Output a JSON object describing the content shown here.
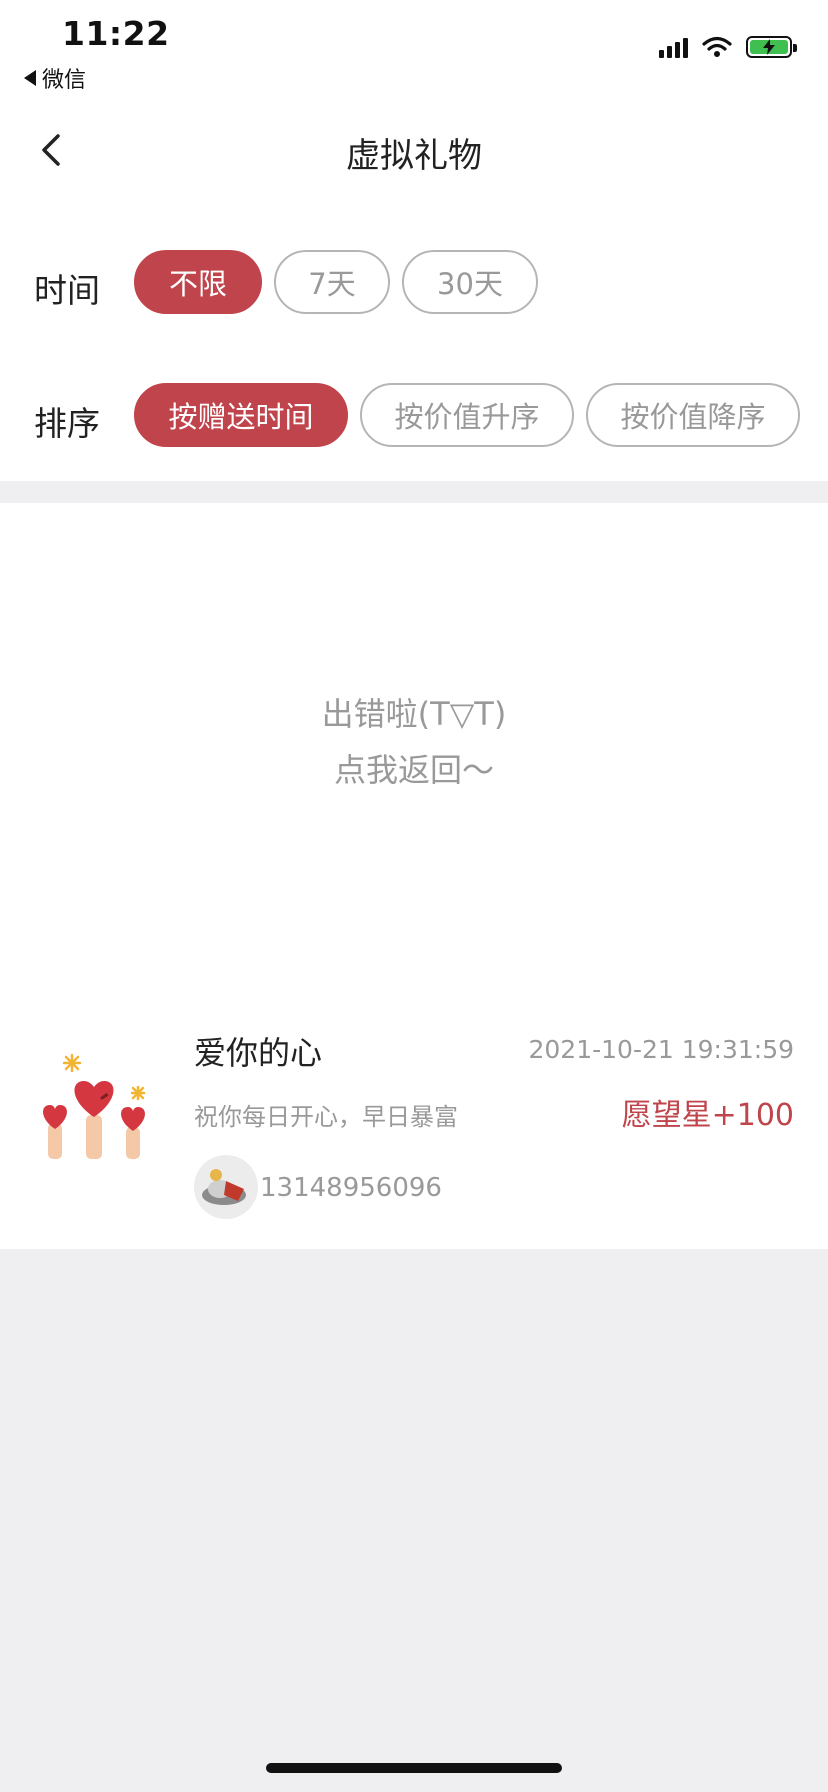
{
  "status_bar": {
    "time": "11:22",
    "back_app": "微信",
    "icons": [
      "signal-icon",
      "wifi-icon",
      "battery-charging-icon"
    ]
  },
  "nav": {
    "title": "虚拟礼物",
    "back_icon": "chevron-left-icon"
  },
  "filters": {
    "time_label": "时间",
    "time_options": [
      "不限",
      "7天",
      "30天"
    ],
    "time_selected": "不限",
    "sort_label": "排序",
    "sort_options": [
      "按赠送时间",
      "按价值升序",
      "按价值降序"
    ],
    "sort_selected": "按赠送时间"
  },
  "error": {
    "line1": "出错啦(T▽T)",
    "line2": "点我返回～"
  },
  "gift": {
    "name": "爱你的心",
    "time": "2021-10-21 19:31:59",
    "message": "祝你每日开心，早日暴富",
    "reward": "愿望星+100",
    "sender": "13148956096",
    "image_icon": "hearts-in-hands-icon"
  },
  "colors": {
    "accent": "#c0444b",
    "background": "#efeff1",
    "muted_text": "#999999"
  }
}
